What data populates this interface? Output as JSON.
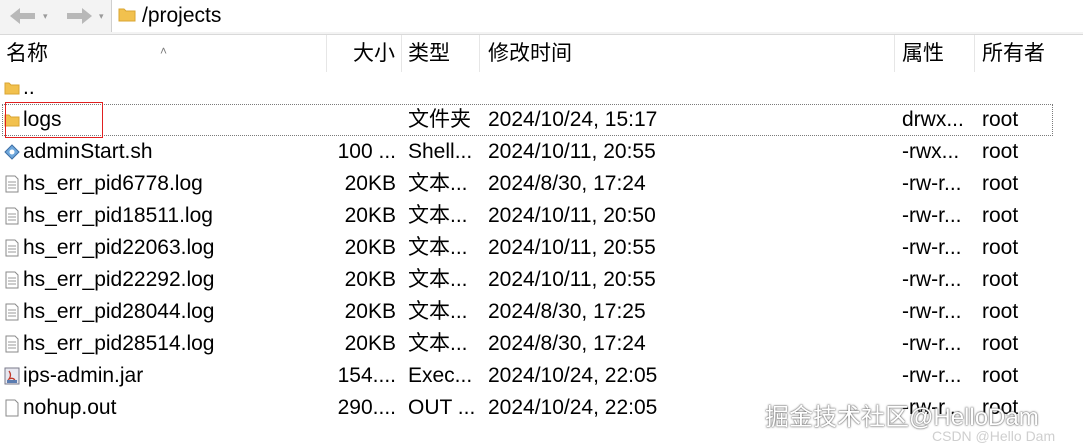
{
  "toolbar": {
    "back_icon": "arrow-left-icon",
    "forward_icon": "arrow-right-icon",
    "path": "/projects"
  },
  "columns": {
    "name": "名称",
    "size": "大小",
    "type": "类型",
    "modified": "修改时间",
    "attributes": "属性",
    "owner": "所有者"
  },
  "rows": [
    {
      "icon": "parent-folder-icon",
      "name": "..",
      "size": "",
      "type": "",
      "modified": "",
      "attributes": "",
      "owner": ""
    },
    {
      "icon": "folder-icon",
      "name": "logs",
      "size": "",
      "type": "文件夹",
      "modified": "2024/10/24, 15:17",
      "attributes": "drwx...",
      "owner": "root"
    },
    {
      "icon": "shell-script-icon",
      "name": "adminStart.sh",
      "size": "100 ...",
      "type": "Shell...",
      "modified": "2024/10/11, 20:55",
      "attributes": "-rwx...",
      "owner": "root"
    },
    {
      "icon": "text-file-icon",
      "name": "hs_err_pid6778.log",
      "size": "20KB",
      "type": "文本...",
      "modified": "2024/8/30, 17:24",
      "attributes": "-rw-r...",
      "owner": "root"
    },
    {
      "icon": "text-file-icon",
      "name": "hs_err_pid18511.log",
      "size": "20KB",
      "type": "文本...",
      "modified": "2024/10/11, 20:50",
      "attributes": "-rw-r...",
      "owner": "root"
    },
    {
      "icon": "text-file-icon",
      "name": "hs_err_pid22063.log",
      "size": "20KB",
      "type": "文本...",
      "modified": "2024/10/11, 20:55",
      "attributes": "-rw-r...",
      "owner": "root"
    },
    {
      "icon": "text-file-icon",
      "name": "hs_err_pid22292.log",
      "size": "20KB",
      "type": "文本...",
      "modified": "2024/10/11, 20:55",
      "attributes": "-rw-r...",
      "owner": "root"
    },
    {
      "icon": "text-file-icon",
      "name": "hs_err_pid28044.log",
      "size": "20KB",
      "type": "文本...",
      "modified": "2024/8/30, 17:25",
      "attributes": "-rw-r...",
      "owner": "root"
    },
    {
      "icon": "text-file-icon",
      "name": "hs_err_pid28514.log",
      "size": "20KB",
      "type": "文本...",
      "modified": "2024/8/30, 17:24",
      "attributes": "-rw-r...",
      "owner": "root"
    },
    {
      "icon": "jar-file-icon",
      "name": "ips-admin.jar",
      "size": "154....",
      "type": "Exec...",
      "modified": "2024/10/24, 22:05",
      "attributes": "-rw-r...",
      "owner": "root"
    },
    {
      "icon": "blank-file-icon",
      "name": "nohup.out",
      "size": "290....",
      "type": "OUT ...",
      "modified": "2024/10/24, 22:05",
      "attributes": "-rw-r...",
      "owner": "root"
    }
  ],
  "watermark": {
    "main": "掘金技术社区@HelloDam",
    "sub": "CSDN @Hello Dam"
  },
  "colors": {
    "folder": "#f2c14e",
    "highlight": "#e02020",
    "header_divider": "#e6e6e6"
  }
}
